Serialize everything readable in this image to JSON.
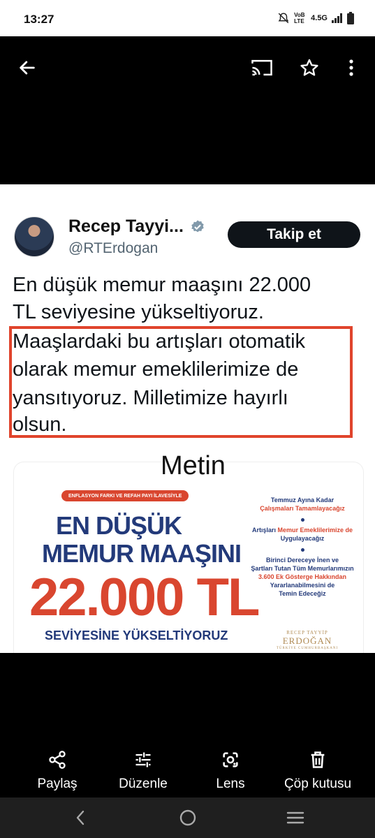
{
  "status_bar": {
    "time": "13:27",
    "network": "4.5G",
    "volte": "VoB LTE"
  },
  "viewer": {
    "icons": [
      "back-arrow-icon",
      "cast-icon",
      "star-icon",
      "more-vert-icon"
    ]
  },
  "tweet": {
    "author_name": "Recep Tayyi...",
    "handle": "@RTErdogan",
    "follow_label": "Takip et",
    "lines": [
      "En düşük memur maaşını 22.000",
      "TL seviyesine yükseltiyoruz.",
      "Maaşlardaki bu artışları otomatik",
      "olarak memur emeklilerimize de",
      "yansıtıyoruz. Milletimize hayırlı",
      "olsun."
    ],
    "overlay_label": "Metin",
    "card": {
      "pill": "ENFLASYON FARKI VE REFAH PAYI İLAVESİYLE",
      "title_line1": "EN DÜŞÜK",
      "title_line2": "MEMUR MAAŞINI",
      "big_value": "22.000 TL",
      "subtitle": "SEVİYESİNE YÜKSELTİYORUZ",
      "item1_line1": "Temmuz Ayına Kadar",
      "item1_line2": "Çalışmaları Tamamlayacağız",
      "item2_a": "Artışları ",
      "item2_b": "Memur Emeklilerimize de",
      "item2_line2": "Uygulayacağız",
      "item3_line1": "Birinci Dereceye İnen ve",
      "item3_line2": "Şartları Tutan Tüm Memurlarımızın",
      "item3_line3": "3.600 Ek Gösterge Hakkından",
      "item3_line4": "Yararlanabilmesini de",
      "item3_line5": "Temin Edeceğiz",
      "sign_small": "RECEP TAYYİP",
      "sign_big": "ERDOĞAN",
      "sign_caption": "TÜRKİYE CUMHURBAŞKANI"
    }
  },
  "actions": [
    {
      "label": "Paylaş",
      "icon": "share-icon"
    },
    {
      "label": "Düzenle",
      "icon": "tune-icon"
    },
    {
      "label": "Lens",
      "icon": "lens-icon"
    },
    {
      "label": "Çöp kutusu",
      "icon": "trash-icon"
    }
  ],
  "nav": [
    "back-nav-icon",
    "home-nav-icon",
    "recents-nav-icon"
  ],
  "colors": {
    "accent_red": "#e0442c",
    "navy": "#233a7a",
    "verified_gray": "#829aab"
  }
}
